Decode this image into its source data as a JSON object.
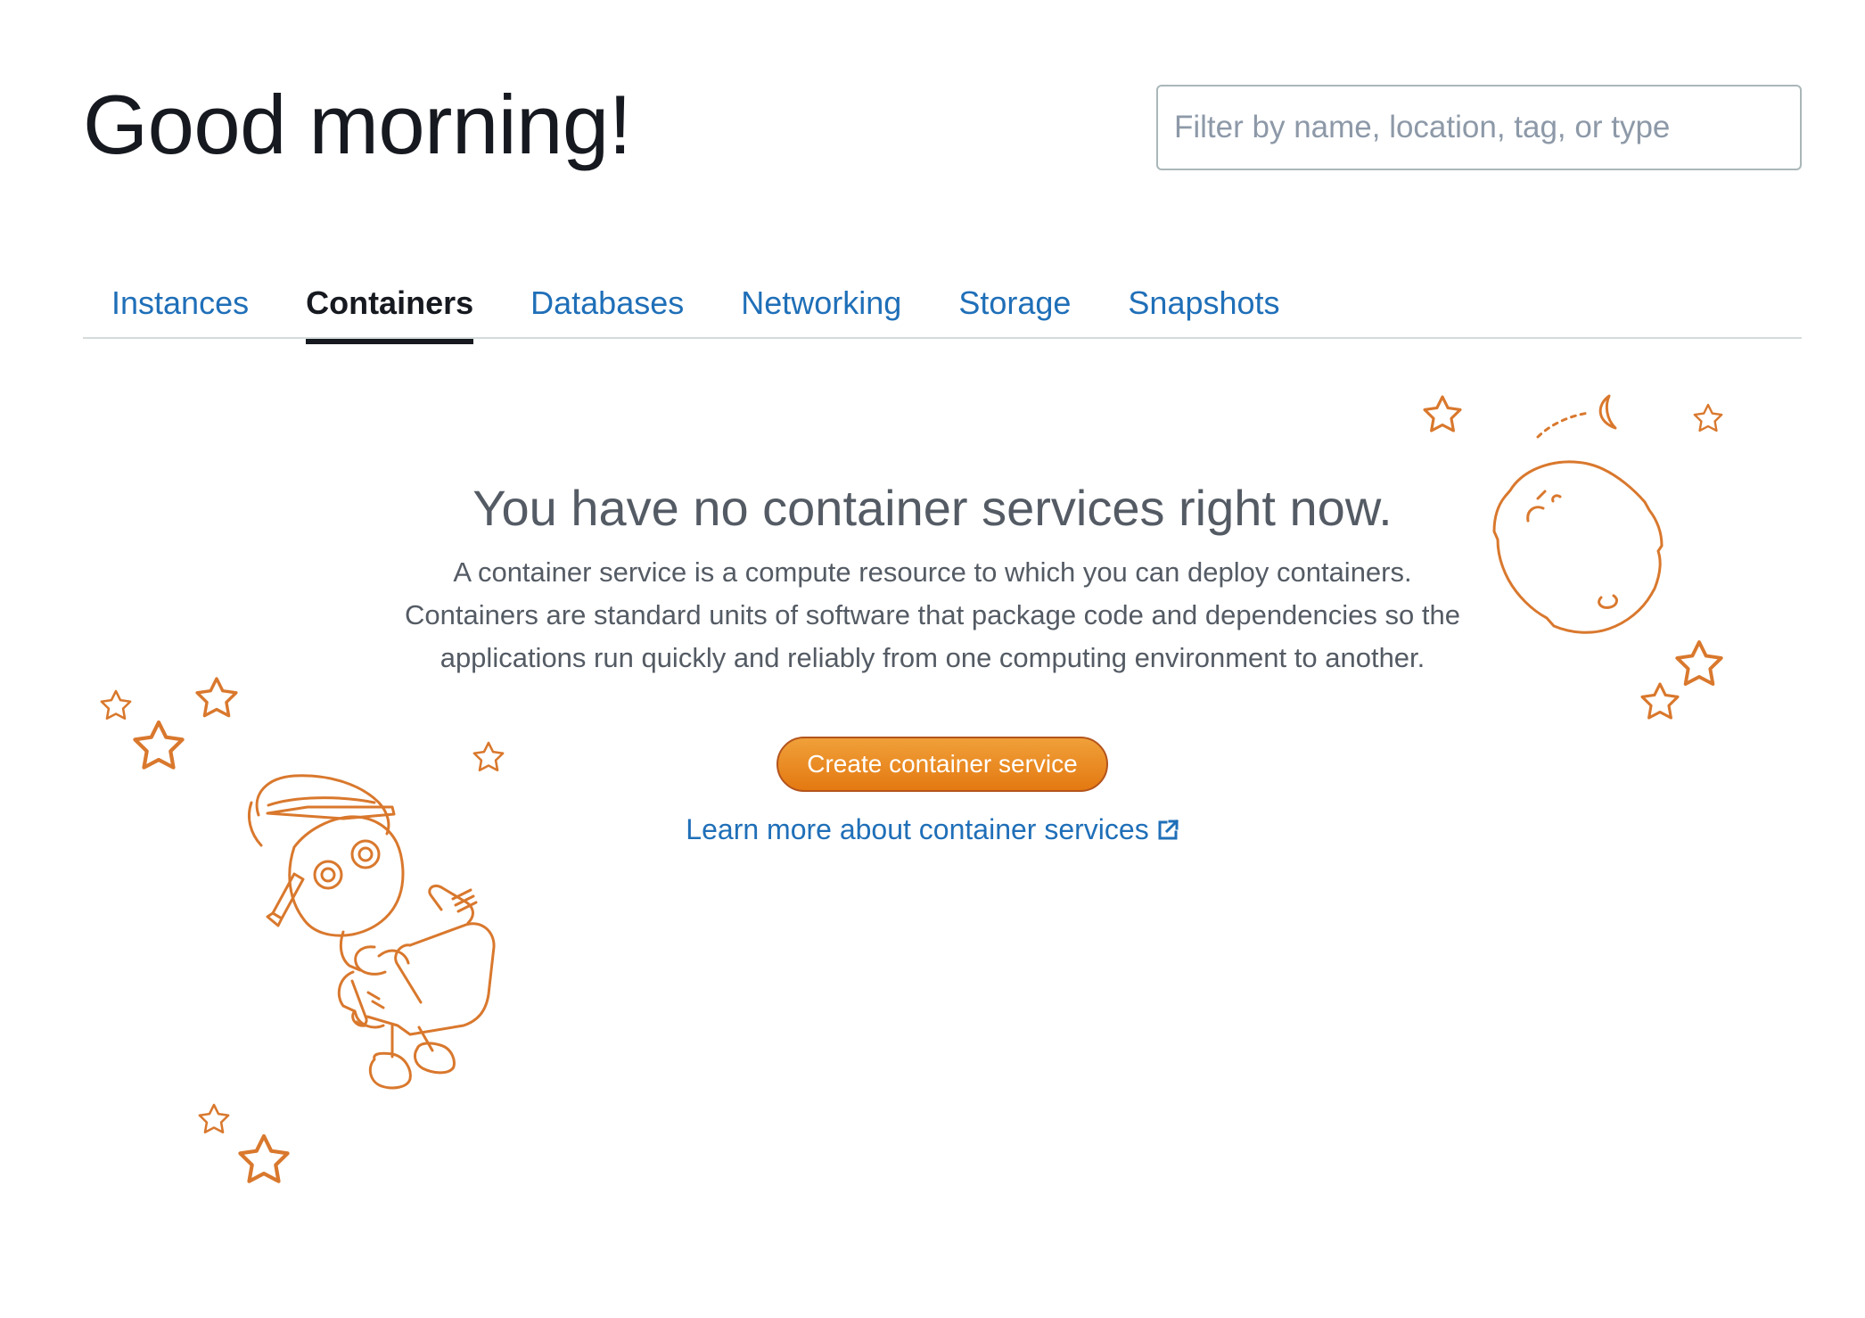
{
  "header": {
    "greeting": "Good morning!"
  },
  "search": {
    "placeholder": "Filter by name, location, tag, or type",
    "value": ""
  },
  "tabs": [
    {
      "label": "Instances",
      "active": false
    },
    {
      "label": "Containers",
      "active": true
    },
    {
      "label": "Databases",
      "active": false
    },
    {
      "label": "Networking",
      "active": false
    },
    {
      "label": "Storage",
      "active": false
    },
    {
      "label": "Snapshots",
      "active": false
    }
  ],
  "empty_state": {
    "title": "You have no container services right now.",
    "description": "A container service is a compute resource to which you can deploy containers. Containers are standard units of software that package code and dependencies so the applications run quickly and reliably from one computing environment to another.",
    "create_button_label": "Create container service",
    "learn_more_label": "Learn more about container services",
    "learn_more_icon": "external-link-icon"
  },
  "illustration": {
    "icons": [
      "robot-astronaut-icon",
      "moon-icon",
      "star-icon"
    ]
  },
  "colors": {
    "accent_orange": "#e47911",
    "illustration_orange": "#d9782d",
    "link_blue": "#1f6fb8",
    "text_dark": "#16191f",
    "text_muted": "#545b64"
  }
}
